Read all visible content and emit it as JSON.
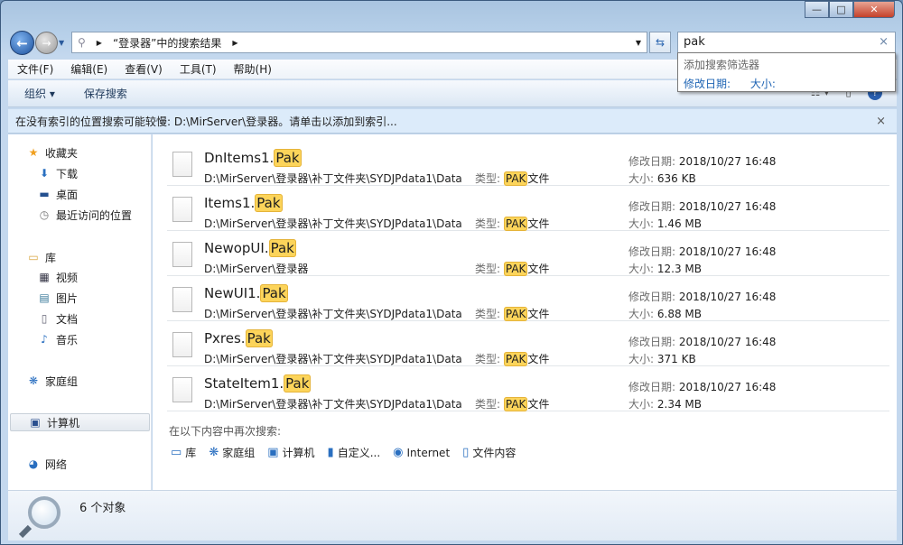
{
  "window": {
    "min": "—",
    "max": "□",
    "close": "✕"
  },
  "address": {
    "path": "“登录器”中的搜索结果"
  },
  "search": {
    "value": "pak",
    "clear": "×",
    "suggest_header": "添加搜索筛选器",
    "filters": [
      "修改日期:",
      "大小:"
    ]
  },
  "menu": [
    "文件(F)",
    "编辑(E)",
    "查看(V)",
    "工具(T)",
    "帮助(H)"
  ],
  "toolbar": {
    "organize": "组织 ▾",
    "save_search": "保存搜索",
    "help": "?"
  },
  "info_bar": {
    "text": "在没有索引的位置搜索可能较慢: D:\\MirServer\\登录器。请单击以添加到索引...",
    "close": "×"
  },
  "sidebar": {
    "items": [
      {
        "label": "收藏夹",
        "icon": "star-icon",
        "glyph": "★",
        "color": "#f0a020"
      },
      {
        "label": "下载",
        "icon": "downloads-icon",
        "glyph": "⬇",
        "color": "#2a70c0"
      },
      {
        "label": "桌面",
        "icon": "desktop-icon",
        "glyph": "▬",
        "color": "#24508f"
      },
      {
        "label": "最近访问的位置",
        "icon": "recent-places-icon",
        "glyph": "◷",
        "color": "#777"
      },
      {
        "label": "库",
        "icon": "library-icon",
        "glyph": "▭",
        "color": "#d9a640"
      },
      {
        "label": "视频",
        "icon": "video-icon",
        "glyph": "▦",
        "color": "#334"
      },
      {
        "label": "图片",
        "icon": "pictures-icon",
        "glyph": "▤",
        "color": "#3a7a9a"
      },
      {
        "label": "文档",
        "icon": "documents-icon",
        "glyph": "▯",
        "color": "#667"
      },
      {
        "label": "音乐",
        "icon": "music-icon",
        "glyph": "♪",
        "color": "#2a6fc0"
      },
      {
        "label": "家庭组",
        "icon": "homegroup-icon",
        "glyph": "❋",
        "color": "#2a6fc0"
      },
      {
        "label": "计算机",
        "icon": "computer-icon",
        "glyph": "▣",
        "color": "#2a4f8f"
      },
      {
        "label": "网络",
        "icon": "network-icon",
        "glyph": "◕",
        "color": "#2a6fc0"
      }
    ]
  },
  "labels": {
    "type": "类型:",
    "type_suffix": "文件",
    "date": "修改日期:",
    "size": "大小:"
  },
  "files": [
    {
      "base": "DnItems1.",
      "ext": "Pak",
      "path": "D:\\MirServer\\登录器\\补丁文件夹\\SYDJPdata1\\Data",
      "type": "PAK",
      "date": "2018/10/27 16:48",
      "size": "636 KB"
    },
    {
      "base": "Items1.",
      "ext": "Pak",
      "path": "D:\\MirServer\\登录器\\补丁文件夹\\SYDJPdata1\\Data",
      "type": "PAK",
      "date": "2018/10/27 16:48",
      "size": "1.46 MB"
    },
    {
      "base": "NewopUI.",
      "ext": "Pak",
      "path": "D:\\MirServer\\登录器",
      "type": "PAK",
      "date": "2018/10/27 16:48",
      "size": "12.3 MB"
    },
    {
      "base": "NewUI1.",
      "ext": "Pak",
      "path": "D:\\MirServer\\登录器\\补丁文件夹\\SYDJPdata1\\Data",
      "type": "PAK",
      "date": "2018/10/27 16:48",
      "size": "6.88 MB"
    },
    {
      "base": "Pxres.",
      "ext": "Pak",
      "path": "D:\\MirServer\\登录器\\补丁文件夹\\SYDJPdata1\\Data",
      "type": "PAK",
      "date": "2018/10/27 16:48",
      "size": "371 KB"
    },
    {
      "base": "StateItem1.",
      "ext": "Pak",
      "path": "D:\\MirServer\\登录器\\补丁文件夹\\SYDJPdata1\\Data",
      "type": "PAK",
      "date": "2018/10/27 16:48",
      "size": "2.34 MB"
    }
  ],
  "search_again": {
    "label": "在以下内容中再次搜索:",
    "locations": [
      {
        "label": "库",
        "icon": "library-icon",
        "glyph": "▭"
      },
      {
        "label": "家庭组",
        "icon": "homegroup-icon",
        "glyph": "❋"
      },
      {
        "label": "计算机",
        "icon": "computer-icon",
        "glyph": "▣"
      },
      {
        "label": "自定义...",
        "icon": "custom-folder-icon",
        "glyph": "▮"
      },
      {
        "label": "Internet",
        "icon": "internet-icon",
        "glyph": "◉"
      },
      {
        "label": "文件内容",
        "icon": "file-contents-icon",
        "glyph": "▯"
      }
    ]
  },
  "status": {
    "count": "6 个对象"
  },
  "highlight_color": "#fcd45a"
}
